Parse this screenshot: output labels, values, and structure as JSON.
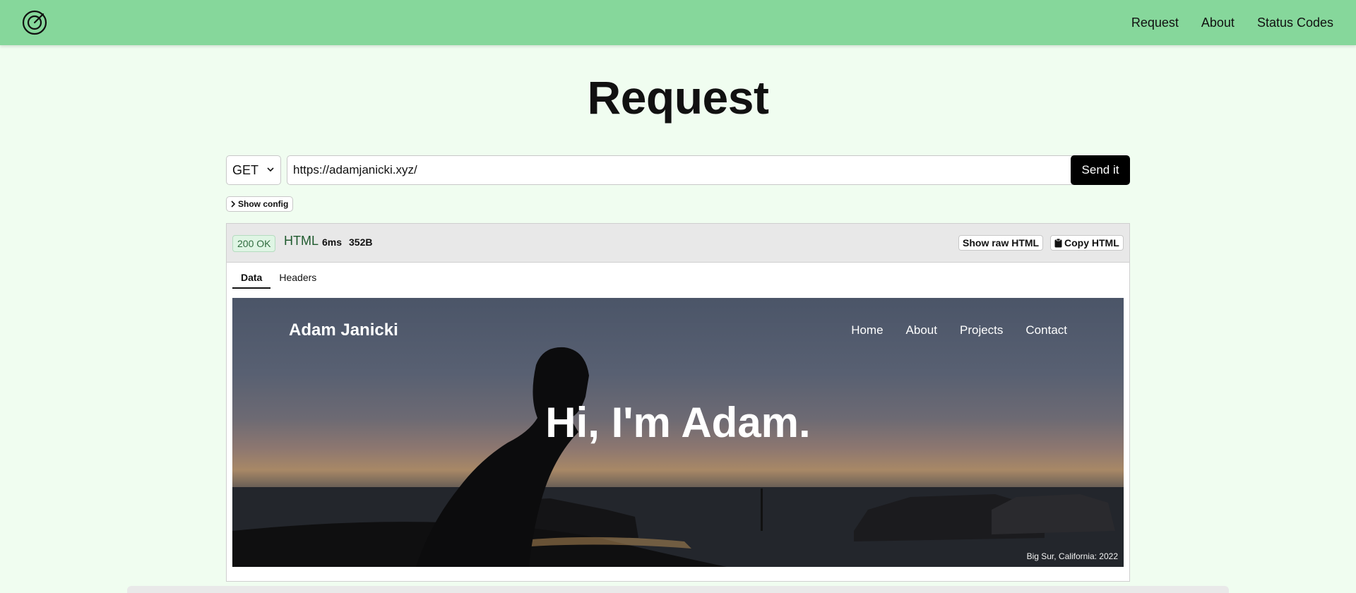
{
  "topnav": {
    "items": [
      "Request",
      "About",
      "Status Codes"
    ]
  },
  "page": {
    "title": "Request"
  },
  "request": {
    "method": "GET",
    "url": "https://adamjanicki.xyz/",
    "send_label": "Send it",
    "config_label": "Show config"
  },
  "response": {
    "status": "200 OK",
    "type": "HTML",
    "time": "6ms",
    "size": "352B",
    "raw_label": "Show raw HTML",
    "copy_label": "Copy HTML",
    "tabs": [
      "Data",
      "Headers"
    ],
    "active_tab": "Data"
  },
  "preview": {
    "site_name": "Adam Janicki",
    "nav": [
      "Home",
      "About",
      "Projects",
      "Contact"
    ],
    "heading": "Hi, I'm Adam.",
    "caption": "Big Sur, California: 2022"
  },
  "colors": {
    "topbar": "#86d79b",
    "background": "#f0fdf0",
    "send_button": "#000000",
    "status_badge": "#dff5e4"
  },
  "icons": [
    "logo-target-icon",
    "chevron-down-icon",
    "chevron-right-icon",
    "clipboard-icon"
  ]
}
